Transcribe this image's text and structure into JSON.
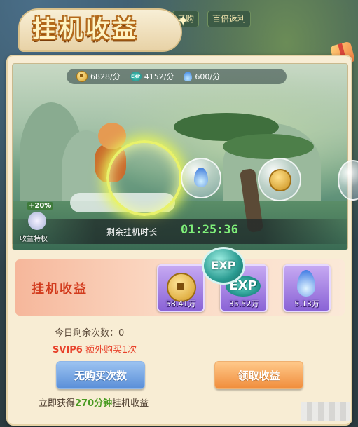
{
  "header": {
    "title": "挂机收益",
    "bg_tabs": [
      "元购",
      "百倍返利"
    ]
  },
  "scene": {
    "stats": [
      {
        "icon": "coin-icon",
        "value": "6828/分"
      },
      {
        "icon": "exp-icon",
        "value": "4152/分"
      },
      {
        "icon": "flame-icon",
        "value": "600/分"
      }
    ],
    "timer_label": "剩余挂机时长",
    "timer_value": "01:25:36",
    "privilege": {
      "bonus": "+20%",
      "label": "收益特权"
    }
  },
  "rewards": {
    "title": "挂机收益",
    "badge": "EXP",
    "items": [
      {
        "icon": "coin-icon",
        "amount": "58.41万"
      },
      {
        "icon": "exp-icon",
        "label": "EXP",
        "amount": "35.52万"
      },
      {
        "icon": "flame-icon",
        "amount": "5.13万"
      }
    ]
  },
  "info": {
    "remaining_label": "今日剩余次数：",
    "remaining_value": "0",
    "svip_tag": "SVIP6",
    "svip_text": " 额外购买1次"
  },
  "buttons": {
    "buy": "无购买次数",
    "collect": "领取收益"
  },
  "footer": {
    "prefix": "立即获得",
    "highlight": "270分钟",
    "suffix": "挂机收益"
  },
  "colors": {
    "accent_red": "#e8412a",
    "timer_green": "#7ff07a",
    "button_blue": "#5a8fd8",
    "button_orange": "#f08d3c"
  }
}
